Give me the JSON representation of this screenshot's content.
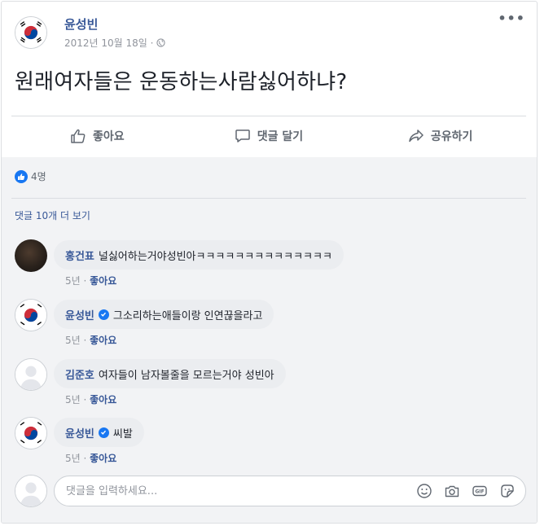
{
  "post": {
    "author": "윤성빈",
    "date": "2012년 10월 18일 ·",
    "text": "원래여자들은 운동하는사람싫어하냐?",
    "more_icon": "more-horizontal-icon",
    "privacy_icon": "globe-icon"
  },
  "actions": {
    "like": "좋아요",
    "comment": "댓글 달기",
    "share": "공유하기"
  },
  "reactions": {
    "count": "4명"
  },
  "view_more": "댓글 10개 더 보기",
  "comments": [
    {
      "name": "홍건표",
      "verified": false,
      "text": "널싫어하는거야성빈아ㅋㅋㅋㅋㅋㅋㅋㅋㅋㅋㅋㅋㅋㅋ",
      "time": "5년 · ",
      "like": "좋아요",
      "avatar": "photo"
    },
    {
      "name": "윤성빈",
      "verified": true,
      "text": "그소리하는애들이랑 인연끊을라고",
      "time": "5년 · ",
      "like": "좋아요",
      "avatar": "flag"
    },
    {
      "name": "김준호",
      "verified": false,
      "text": "여자들이 남자볼줄을 모르는거야 성빈아",
      "time": "5년 · ",
      "like": "좋아요",
      "avatar": "blank"
    },
    {
      "name": "윤성빈",
      "verified": true,
      "text": "씨발",
      "time": "5년 · ",
      "like": "좋아요",
      "avatar": "flag"
    }
  ],
  "comment_input": {
    "placeholder": "댓글을 입력하세요..."
  },
  "colors": {
    "link": "#385898",
    "accent": "#1877f2",
    "bubble": "#ebedf0",
    "feedback_bg": "#f2f3f5"
  }
}
